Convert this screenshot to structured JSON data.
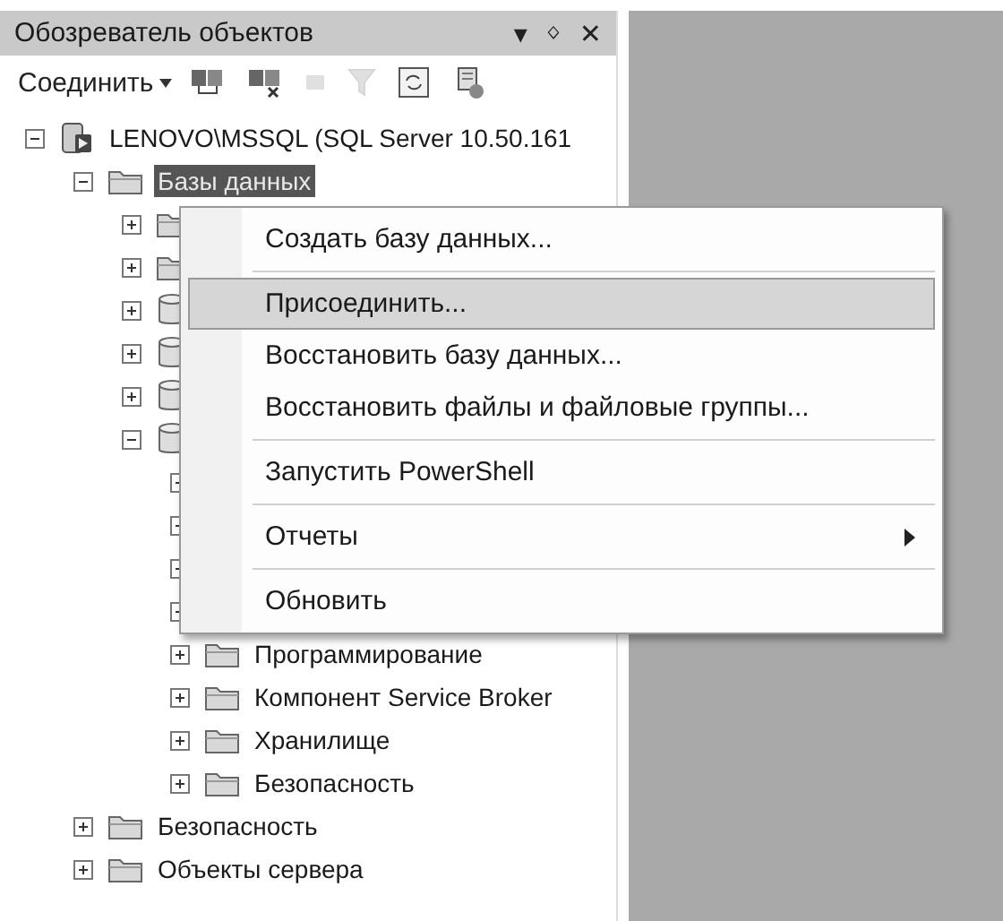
{
  "panel": {
    "title": "Обозреватель объектов",
    "title_buttons": [
      "▾",
      "ᛜ",
      "✕"
    ]
  },
  "toolbar": {
    "connect_label": "Соединить",
    "buttons": [
      {
        "kind": "connect",
        "disabled": false
      },
      {
        "kind": "disconnect",
        "disabled": false
      },
      {
        "kind": "stop",
        "disabled": true
      },
      {
        "kind": "filter",
        "disabled": true
      },
      {
        "kind": "refresh",
        "disabled": false
      },
      {
        "kind": "script",
        "disabled": false
      }
    ]
  },
  "tree": [
    {
      "kind": "server",
      "label": "LENOVO\\MSSQL (SQL Server 10.50.161",
      "expanded": true,
      "children": [
        {
          "kind": "folder",
          "label": "Базы данных",
          "selected": true,
          "expanded": true,
          "children": [
            {
              "kind": "folder",
              "expanded": false
            },
            {
              "kind": "folder",
              "expanded": false
            },
            {
              "kind": "database",
              "expanded": false
            },
            {
              "kind": "database",
              "expanded": false
            },
            {
              "kind": "database",
              "expanded": false
            },
            {
              "kind": "database",
              "expanded": true,
              "children": [
                {
                  "expanded": false
                },
                {
                  "expanded": false
                },
                {
                  "expanded": false
                },
                {
                  "expanded": false
                },
                {
                  "kind": "folder",
                  "label": "Программирование",
                  "expanded": false
                },
                {
                  "kind": "folder",
                  "label": "Компонент Service Broker",
                  "expanded": false
                },
                {
                  "kind": "folder",
                  "label": "Хранилище",
                  "expanded": false
                },
                {
                  "kind": "folder",
                  "label": "Безопасность",
                  "expanded": false
                }
              ]
            }
          ]
        },
        {
          "kind": "folder",
          "label": "Безопасность",
          "expanded": false
        },
        {
          "kind": "folder",
          "label": "Объекты сервера",
          "expanded": false
        }
      ]
    }
  ],
  "context_menu": [
    {
      "kind": "item",
      "label": "Создать базу данных...",
      "selected": false
    },
    {
      "kind": "separator"
    },
    {
      "kind": "item",
      "label": "Присоединить...",
      "selected": true
    },
    {
      "kind": "item",
      "label": "Восстановить базу данных...",
      "selected": false
    },
    {
      "kind": "item",
      "label": "Восстановить файлы и файловые группы...",
      "selected": false
    },
    {
      "kind": "separator"
    },
    {
      "kind": "item",
      "label": "Запустить PowerShell",
      "selected": false
    },
    {
      "kind": "separator"
    },
    {
      "kind": "submenu",
      "label": "Отчеты",
      "selected": false
    },
    {
      "kind": "separator"
    },
    {
      "kind": "item",
      "label": "Обновить",
      "selected": false
    }
  ]
}
